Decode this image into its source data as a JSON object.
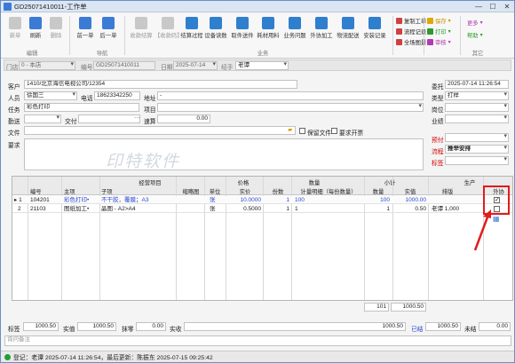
{
  "window": {
    "title": "GD25071410011-工作单"
  },
  "ribbon": {
    "edit": {
      "new": "新单",
      "refresh": "刷新",
      "delete": "删除",
      "group": "编辑"
    },
    "nav": {
      "prev": "前一单",
      "next": "后一单",
      "group": "导航"
    },
    "business": {
      "collect": "收款结算",
      "recharge": "【收款码】",
      "settle": "结算过程",
      "device_count": "设备读数",
      "take": "取件送件",
      "material": "耗材用料",
      "workflow": "业务问题",
      "outsource": "外协加工",
      "logistics": "物流配送",
      "install": "安装记录",
      "group": "业务"
    },
    "copy": {
      "copy_order": "复制工单",
      "flow_record": "流程记录",
      "full_view": "全场图景"
    },
    "save": {
      "save": "保存",
      "print": "打印",
      "audit": "审核"
    },
    "more": {
      "more": "更多",
      "help": "帮助",
      "group": "其它"
    }
  },
  "header": {
    "store_label": "门店",
    "store": "0 - 本店",
    "no_label": "编号",
    "no": "GD25071410011",
    "date_label": "日期",
    "date": "2025-07-14",
    "handler_label": "经手",
    "handler": "老谭"
  },
  "form": {
    "customer_label": "客户",
    "customer": "1410/北京海信电视公司/12354",
    "person_label": "人员",
    "person": "徐国三",
    "phone_label": "电话",
    "phone": "18623342250",
    "addr_label": "地址",
    "addr": "-",
    "task_label": "任务",
    "task": "彩色打印",
    "project_label": "项目",
    "project": "",
    "delivery_label": "勤送",
    "delivery": "",
    "pay_label": "交付",
    "pay": "",
    "fee_label": "速算",
    "fee": "0.00",
    "file_label": "文件",
    "file": "",
    "keep_file": "保留文件",
    "req_mount": "要求开票",
    "req_label": "要求",
    "watermark": "印特软件",
    "right": {
      "entrust_label": "委托",
      "entrust": "2025-07-14 11:26:54",
      "type_label": "类型",
      "type": "打样",
      "post_label": "岗位",
      "post": "",
      "biz_label": "业绩",
      "biz": "",
      "remind_label": "预付",
      "remind": "",
      "flow_label": "流程",
      "flow": "推举安排",
      "tag_label": "标签",
      "tag": ""
    }
  },
  "grid": {
    "group_headers": {
      "project": "经营项目",
      "price": "价格",
      "qty": "数量",
      "subtotal": "小计",
      "production": "生产"
    },
    "headers": [
      "编号",
      "主项",
      "子项",
      "缩略图",
      "单位",
      "实价",
      "份数",
      "计量明细（每份数量）",
      "数量",
      "实值",
      "排版",
      "外协"
    ],
    "rows": [
      {
        "marker": "▸ 1",
        "code": "104201",
        "main": "彩色打印•",
        "sub": "不干胶，覆膜；A3",
        "unit": "张",
        "price": "10.0000",
        "copies": "1",
        "detail": "100",
        "qty": "100",
        "value": "1000.00",
        "layout": "",
        "outsourced": true
      },
      {
        "marker": "2",
        "code": "21103",
        "main": "图纸加工•",
        "sub": "晶图 - A2>A4",
        "unit": "张",
        "price": "0.5000",
        "copies": "1",
        "detail": "1",
        "qty": "1",
        "value": "0.50",
        "layout": "老谭 1,000",
        "outsourced": false
      }
    ],
    "footer": {
      "qty_total": "101",
      "value_total": "1000.50"
    }
  },
  "totals": {
    "std_label": "标签",
    "std": "1000.50",
    "actual_label": "实值",
    "actual": "1000.50",
    "discount_label": "抹零",
    "discount": "0.00",
    "received_label": "实收",
    "received": "1000.50",
    "status_label": "已结",
    "status": "1000.50",
    "unpaid_label": "未结",
    "unpaid": "0.00",
    "note_placeholder": "询问备注"
  },
  "status": {
    "text": "登记：老谭 2025-07-14 11:26:54，最后更新：陈振东 2025-07-15 09:25:42"
  }
}
